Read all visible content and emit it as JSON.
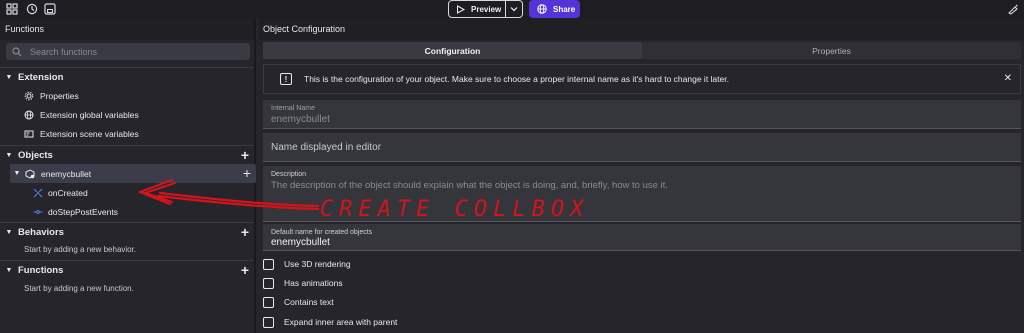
{
  "topbar": {
    "icons": [
      "grid-icon",
      "history-icon",
      "save-icon",
      "paint-icon"
    ],
    "preview_label": "Preview",
    "share_label": "Share"
  },
  "left_panel": {
    "title": "Functions",
    "search_placeholder": "Search functions",
    "extension": {
      "label": "Extension",
      "items": [
        {
          "label": "Properties",
          "icon": "gear-icon"
        },
        {
          "label": "Extension global variables",
          "icon": "globe-icon"
        },
        {
          "label": "Extension scene variables",
          "icon": "scene-icon"
        }
      ]
    },
    "objects": {
      "label": "Objects",
      "object_name": "enemycbullet",
      "functions": [
        {
          "label": "onCreated",
          "icon": "function-icon"
        },
        {
          "label": "doStepPostEvents",
          "icon": "function-icon"
        }
      ]
    },
    "behaviors": {
      "label": "Behaviors",
      "hint": "Start by adding a new behavior."
    },
    "functions": {
      "label": "Functions",
      "hint": "Start by adding a new function."
    }
  },
  "right_panel": {
    "title": "Object Configuration",
    "tabs": [
      {
        "label": "Configuration",
        "active": true
      },
      {
        "label": "Properties",
        "active": false
      }
    ],
    "info_text": "This is the configuration of your object. Make sure to choose a proper internal name as it's hard to change it later.",
    "fields": {
      "internal_name_label": "Internal Name",
      "internal_name_value": "enemycbullet",
      "display_name_placeholder": "Name displayed in editor",
      "description_label": "Description",
      "description_placeholder": "The description of the object should explain what the object is doing, and, briefly, how to use it.",
      "default_name_label": "Default name for created objects",
      "default_name_value": "enemycbullet"
    },
    "checkboxes": [
      {
        "label": "Use 3D rendering",
        "checked": false
      },
      {
        "label": "Has animations",
        "checked": false
      },
      {
        "label": "Contains text",
        "checked": false
      },
      {
        "label": "Expand inner area with parent",
        "checked": false
      }
    ]
  },
  "annotation": {
    "text": "CREATE COLLBOX",
    "color": "#d4141a"
  }
}
